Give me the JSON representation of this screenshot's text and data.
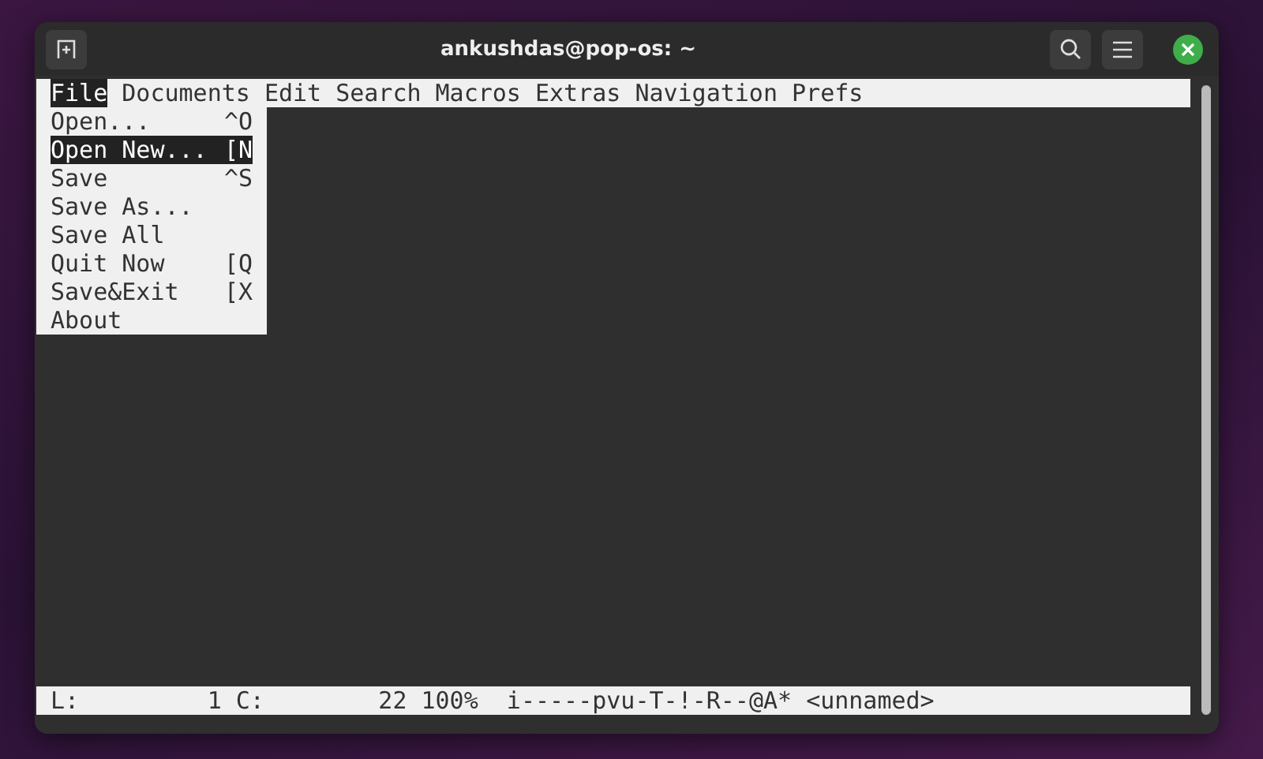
{
  "window": {
    "title": "ankushdas@pop-os: ~"
  },
  "menu_bar": [
    {
      "label": "File",
      "selected": true
    },
    {
      "label": "Documents",
      "selected": false
    },
    {
      "label": "Edit",
      "selected": false
    },
    {
      "label": "Search",
      "selected": false
    },
    {
      "label": "Macros",
      "selected": false
    },
    {
      "label": "Extras",
      "selected": false
    },
    {
      "label": "Navigation",
      "selected": false
    },
    {
      "label": "Prefs",
      "selected": false
    }
  ],
  "file_menu": [
    {
      "label": "Open...",
      "shortcut": "^O",
      "selected": false
    },
    {
      "label": "Open New...",
      "shortcut": "[N",
      "selected": true
    },
    {
      "label": "Save",
      "shortcut": "^S",
      "selected": false
    },
    {
      "label": "Save As...",
      "selected": false
    },
    {
      "label": "Save All",
      "selected": false
    },
    {
      "label": "Quit Now",
      "shortcut": "[Q",
      "selected": false
    },
    {
      "label": "Save&Exit",
      "shortcut": "[X",
      "selected": false
    },
    {
      "label": "About",
      "selected": false
    }
  ],
  "status_bar": {
    "line_label": "L:",
    "line": "1",
    "column_label": "C:",
    "column": "22",
    "zoom": "100%",
    "flags": "i-----pvu-T-!-R--@A*",
    "filename": "<unnamed>"
  }
}
